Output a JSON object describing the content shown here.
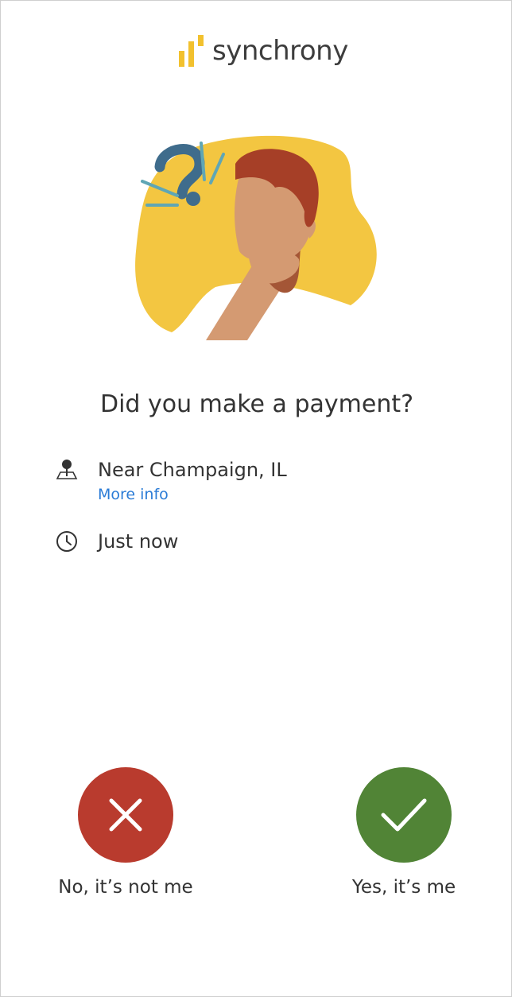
{
  "brand": {
    "name": "synchrony",
    "accent": "#F2C12E"
  },
  "prompt": {
    "question": "Did you make a payment?"
  },
  "details": {
    "location": "Near Champaign, IL",
    "more_info": "More info",
    "time": "Just now",
    "link_color": "#2A7BD6"
  },
  "actions": {
    "deny_label": "No, it’s not me",
    "deny_color": "#B93B2E",
    "confirm_label": "Yes, it’s me",
    "confirm_color": "#518436"
  },
  "icons": {
    "location": "map-pin-icon",
    "time": "clock-icon",
    "deny": "close-icon",
    "confirm": "checkmark-icon"
  }
}
